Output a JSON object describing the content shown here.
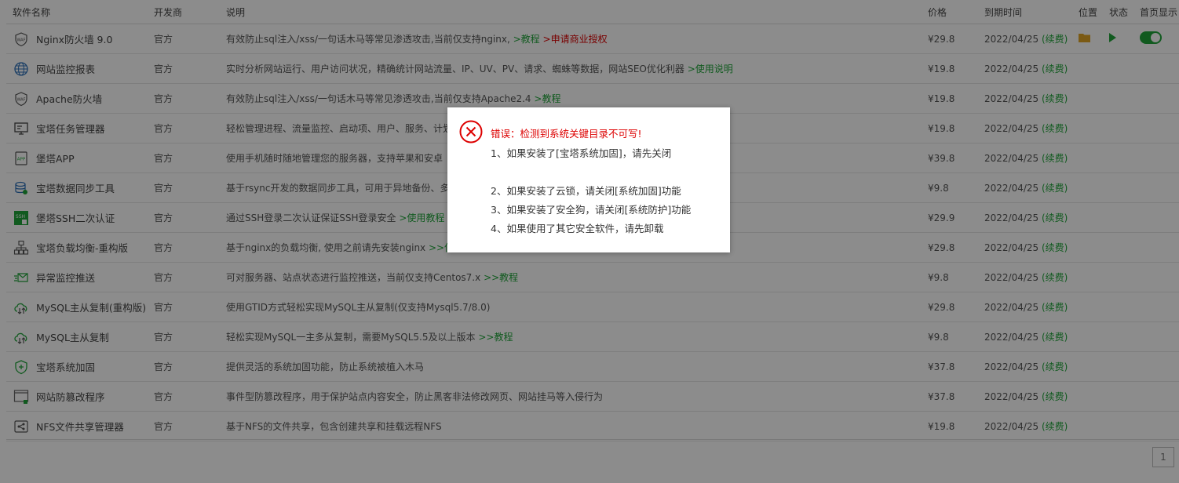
{
  "table": {
    "headers": [
      "软件名称",
      "开发商",
      "说明",
      "价格",
      "到期时间",
      "位置",
      "状态",
      "首页显示"
    ],
    "rows": [
      {
        "icon": "waf-shield-icon",
        "name": "Nginx防火墙 9.0",
        "dev": "官方",
        "desc": "有效防止sql注入/xss/一句话木马等常见渗透攻击,当前仅支持nginx,",
        "link1": ">教程",
        "link2": ">申请商业授权",
        "price": "¥29.8",
        "expire": "2022/04/25",
        "renew": "(续费)"
      },
      {
        "icon": "globe-monitor-icon",
        "name": "网站监控报表",
        "dev": "官方",
        "desc": "实时分析网站运行、用户访问状况，精确统计网站流量、IP、UV、PV、请求、蜘蛛等数据，网站SEO优化利器",
        "link1": ">使用说明",
        "link2": "",
        "price": "¥19.8",
        "expire": "2022/04/25",
        "renew": "(续费)"
      },
      {
        "icon": "waf-shield-icon",
        "name": "Apache防火墙",
        "dev": "官方",
        "desc": "有效防止sql注入/xss/一句话木马等常见渗透攻击,当前仅支持Apache2.4",
        "link1": ">教程",
        "link2": "",
        "price": "¥19.8",
        "expire": "2022/04/25",
        "renew": "(续费)"
      },
      {
        "icon": "task-manager-icon",
        "name": "宝塔任务管理器",
        "dev": "官方",
        "desc": "轻松管理进程、流量监控、启动项、用户、服务、计划任务",
        "link1": "",
        "link2": "",
        "price": "¥19.8",
        "expire": "2022/04/25",
        "renew": "(续费)"
      },
      {
        "icon": "app-icon",
        "name": "堡塔APP",
        "dev": "官方",
        "desc": "使用手机随时随地管理您的服务器，支持苹果和安卓",
        "link1": "",
        "link2": "",
        "price": "¥39.8",
        "expire": "2022/04/25",
        "renew": "(续费)"
      },
      {
        "icon": "database-sync-icon",
        "name": "宝塔数据同步工具",
        "dev": "官方",
        "desc": "基于rsync开发的数据同步工具，可用于异地备份、多",
        "link1": "",
        "link2": "",
        "price": "¥9.8",
        "expire": "2022/04/25",
        "renew": "(续费)"
      },
      {
        "icon": "ssh-auth-icon",
        "name": "堡塔SSH二次认证",
        "dev": "官方",
        "desc": "通过SSH登录二次认证保证SSH登录安全",
        "link1": ">使用教程",
        "link2": "",
        "price": "¥29.9",
        "expire": "2022/04/25",
        "renew": "(续费)"
      },
      {
        "icon": "load-balance-icon",
        "name": "宝塔负载均衡-重构版",
        "dev": "官方",
        "desc": "基于nginx的负载均衡, 使用之前请先安装nginx",
        "link1": ">>使",
        "link2": "",
        "price": "¥29.8",
        "expire": "2022/04/25",
        "renew": "(续费)"
      },
      {
        "icon": "alert-push-icon",
        "name": "异常监控推送",
        "dev": "官方",
        "desc": "可对服务器、站点状态进行监控推送，当前仅支持Centos7.x",
        "link1": ">>教程",
        "link2": "",
        "price": "¥9.8",
        "expire": "2022/04/25",
        "renew": "(续费)"
      },
      {
        "icon": "mysql-replication-icon",
        "name": "MySQL主从复制(重构版)",
        "dev": "官方",
        "desc": "使用GTID方式轻松实现MySQL主从复制(仅支持Mysql5.7/8.0)",
        "link1": "",
        "link2": "",
        "price": "¥29.8",
        "expire": "2022/04/25",
        "renew": "(续费)"
      },
      {
        "icon": "mysql-replication-icon",
        "name": "MySQL主从复制",
        "dev": "官方",
        "desc": "轻松实现MySQL一主多从复制，需要MySQL5.5及以上版本",
        "link1": ">>教程",
        "link2": "",
        "price": "¥9.8",
        "expire": "2022/04/25",
        "renew": "(续费)"
      },
      {
        "icon": "system-harden-icon",
        "name": "宝塔系统加固",
        "dev": "官方",
        "desc": "提供灵活的系统加固功能，防止系统被植入木马",
        "link1": "",
        "link2": "",
        "price": "¥37.8",
        "expire": "2022/04/25",
        "renew": "(续费)"
      },
      {
        "icon": "tamper-proof-icon",
        "name": "网站防篡改程序",
        "dev": "官方",
        "desc": "事件型防篡改程序，用于保护站点内容安全，防止黑客非法修改网页、网站挂马等入侵行为",
        "link1": "",
        "link2": "",
        "price": "¥37.8",
        "expire": "2022/04/25",
        "renew": "(续费)"
      },
      {
        "icon": "nfs-share-icon",
        "name": "NFS文件共享管理器",
        "dev": "官方",
        "desc": "基于NFS的文件共享，包含创建共享和挂载远程NFS",
        "link1": "",
        "link2": "",
        "price": "¥19.8",
        "expire": "2022/04/25",
        "renew": "(续费)"
      }
    ]
  },
  "pager": {
    "current": "1"
  },
  "dialog": {
    "title": "错误：检测到系统关键目录不可写!",
    "lines": [
      "1、如果安装了[宝塔系统加固]，请先关闭",
      "",
      "2、如果安装了云锁，请关闭[系统加固]功能",
      "3、如果安装了安全狗，请关闭[系统防护]功能",
      "4、如果使用了其它安全软件，请先卸载"
    ]
  },
  "colors": {
    "accent": "#20a53a",
    "price": "#d9534f",
    "error": "#dd0000"
  }
}
